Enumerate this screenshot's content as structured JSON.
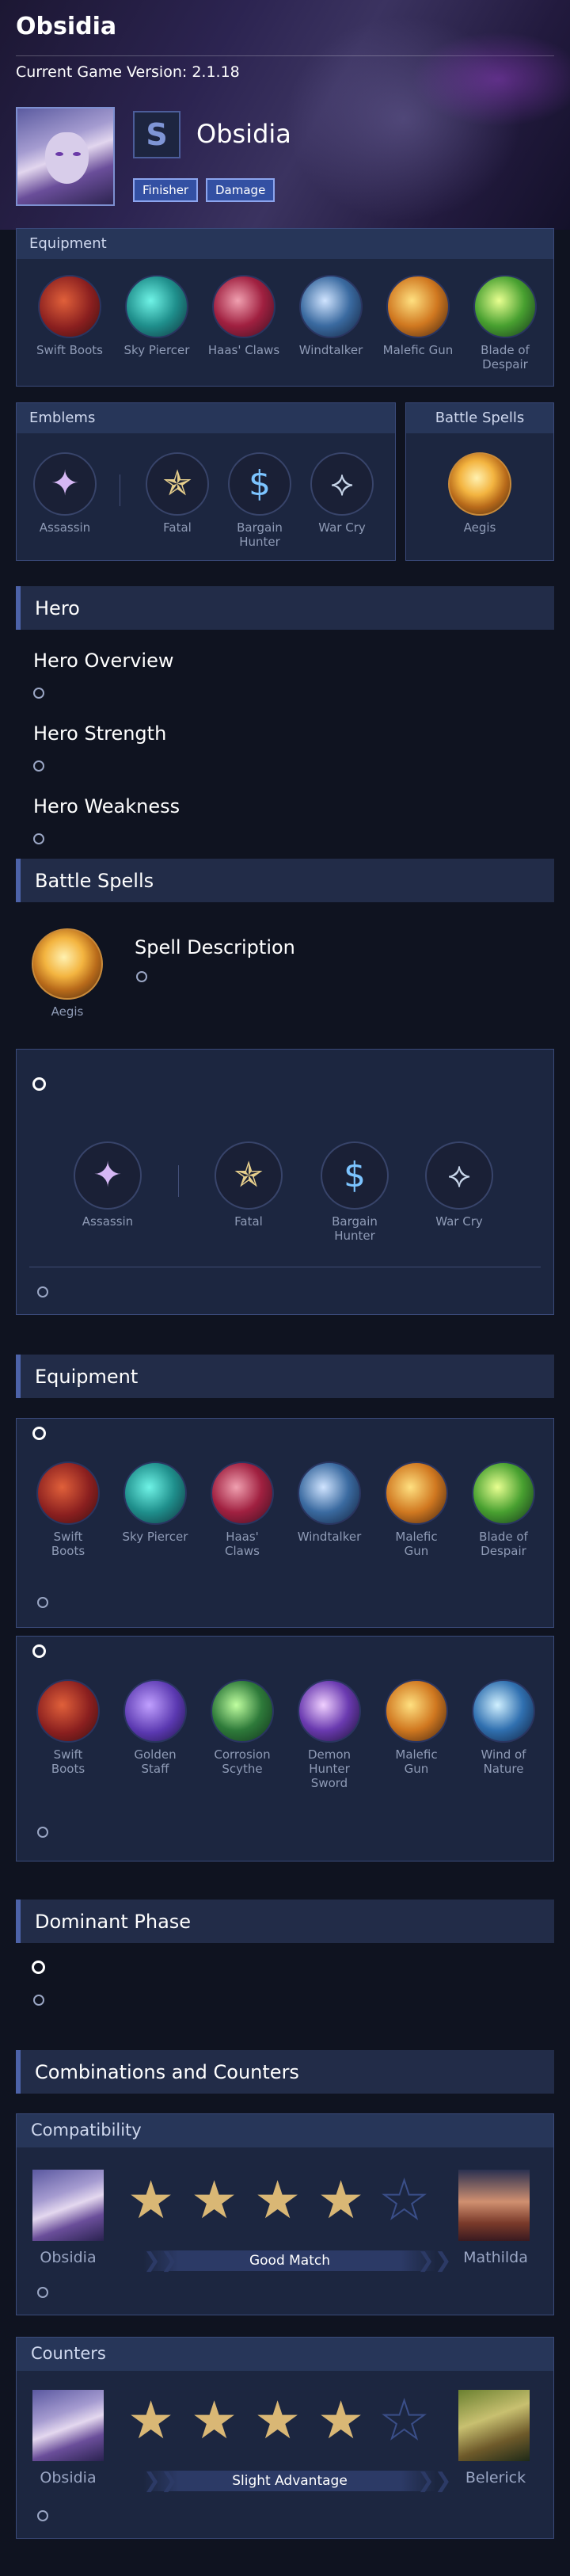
{
  "header": {
    "title": "Obsidia",
    "version": "Current Game Version: 2.1.18",
    "hero_name": "Obsidia",
    "role_icon": "S",
    "tags": [
      "Finisher",
      "Damage"
    ]
  },
  "equipment_panel": {
    "title": "Equipment",
    "items": [
      {
        "label": "Swift Boots",
        "icon": "boots-icon"
      },
      {
        "label": "Sky Piercer",
        "icon": "sky-piercer-icon"
      },
      {
        "label": "Haas' Claws",
        "icon": "claws-icon"
      },
      {
        "label": "Windtalker",
        "icon": "windtalker-icon"
      },
      {
        "label": "Malefic Gun",
        "icon": "gun-icon"
      },
      {
        "label": "Blade of Despair",
        "icon": "blade-icon"
      }
    ]
  },
  "emblems_panel": {
    "title": "Emblems",
    "items": [
      {
        "label": "Assassin",
        "icon": "assassin-emblem-icon"
      },
      {
        "label": "Fatal",
        "icon": "fatal-icon"
      },
      {
        "label": "Bargain Hunter",
        "icon": "bargain-hunter-icon"
      },
      {
        "label": "War Cry",
        "icon": "war-cry-icon"
      }
    ]
  },
  "spells_panel": {
    "title": "Battle Spells",
    "spell": "Aegis"
  },
  "hero_section": {
    "title": "Hero",
    "overview": "Hero Overview",
    "strength": "Hero Strength",
    "weakness": "Hero Weakness"
  },
  "battle_spells_section": {
    "title": "Battle Spells",
    "spell": "Aegis",
    "description_title": "Spell Description"
  },
  "emblem_build": {
    "items": [
      {
        "label": "Assassin"
      },
      {
        "label": "Fatal"
      },
      {
        "label": "Bargain Hunter"
      },
      {
        "label": "War Cry"
      }
    ]
  },
  "equipment_section": {
    "title": "Equipment",
    "build1": [
      {
        "label": "Swift Boots"
      },
      {
        "label": "Sky Piercer"
      },
      {
        "label": "Haas' Claws"
      },
      {
        "label": "Windtalker"
      },
      {
        "label": "Malefic Gun"
      },
      {
        "label": "Blade of Despair"
      }
    ],
    "build2": [
      {
        "label": "Swift Boots"
      },
      {
        "label": "Golden Staff"
      },
      {
        "label": "Corrosion Scythe"
      },
      {
        "label": "Demon Hunter Sword"
      },
      {
        "label": "Malefic Gun"
      },
      {
        "label": "Wind of Nature"
      }
    ]
  },
  "dominant_phase": {
    "title": "Dominant Phase"
  },
  "combos": {
    "title": "Combinations and Counters",
    "compatibility": {
      "title": "Compatibility",
      "left": "Obsidia",
      "right": "Mathilda",
      "stars": 4,
      "max_stars": 5,
      "verdict": "Good Match"
    },
    "counters": {
      "title": "Counters",
      "left": "Obsidia",
      "right": "Belerick",
      "stars": 4,
      "max_stars": 5,
      "verdict": "Slight Advantage"
    }
  },
  "colors": {
    "background": "#0f1320",
    "panel": "#1c2640",
    "accent": "#4c62a8",
    "star": "#d9b775"
  }
}
